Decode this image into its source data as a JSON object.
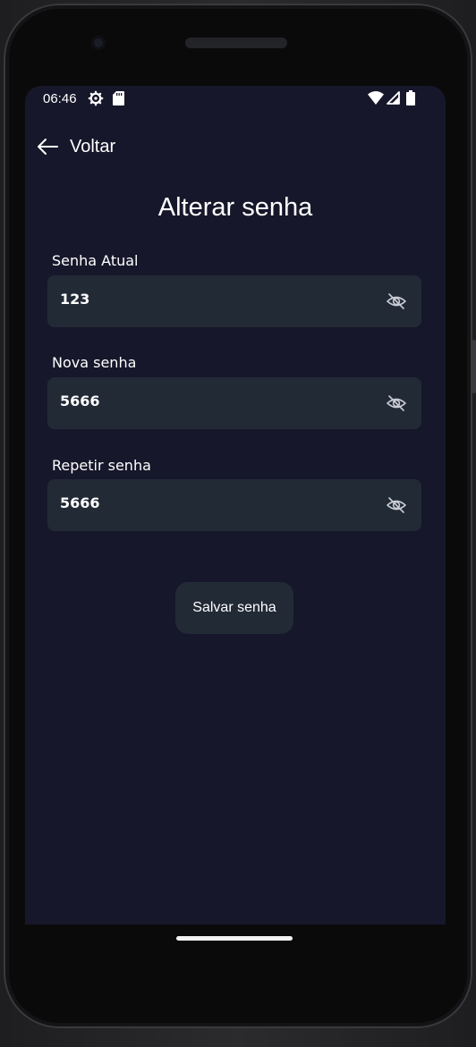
{
  "status_bar": {
    "time": "06:46",
    "icons": [
      "settings-gear-icon",
      "sd-card-icon",
      "wifi-icon",
      "cell-signal-icon",
      "battery-icon"
    ]
  },
  "toolbar": {
    "back_icon": "arrow-left-icon",
    "back_label": "Voltar"
  },
  "page": {
    "title": "Alterar senha"
  },
  "fields": [
    {
      "label": "Senha Atual",
      "value": "123",
      "icon": "eye-off-icon"
    },
    {
      "label": "Nova senha",
      "value": "5666",
      "icon": "eye-off-icon"
    },
    {
      "label": "Repetir senha",
      "value": "5666",
      "icon": "eye-off-icon"
    }
  ],
  "actions": {
    "save_label": "Salvar senha"
  },
  "colors": {
    "background": "#17172b",
    "field_background": "#222a36",
    "text": "#ffffff",
    "icon": "#c9ccd3"
  }
}
